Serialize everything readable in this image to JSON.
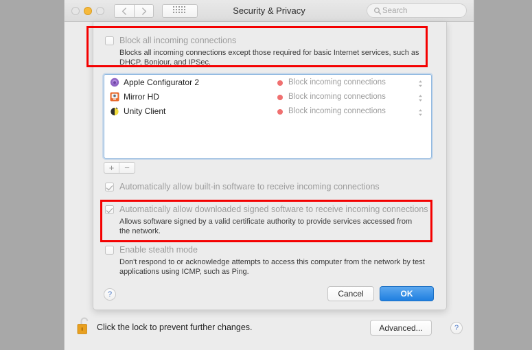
{
  "window": {
    "title": "Security & Privacy",
    "traffic_lights": [
      "close",
      "minimize",
      "zoom"
    ],
    "nav_back": "back",
    "nav_forward": "forward",
    "show_all": "show-all",
    "search_placeholder": "Search"
  },
  "sheet": {
    "block_all": {
      "label": "Block all incoming connections",
      "checked": false,
      "description": "Blocks all incoming connections except those required for basic Internet services, such as DHCP, Bonjour, and IPSec."
    },
    "app_list": {
      "apps": [
        {
          "name": "Apple Configurator 2",
          "icon": "apple-configurator-icon",
          "status": "Block incoming connections",
          "status_color": "#f07070"
        },
        {
          "name": "Mirror HD",
          "icon": "mirror-hd-icon",
          "status": "Block incoming connections",
          "status_color": "#f07070"
        },
        {
          "name": "Unity Client",
          "icon": "unity-client-icon",
          "status": "Block incoming connections",
          "status_color": "#f07070"
        }
      ]
    },
    "add_label": "+",
    "remove_label": "−",
    "builtin": {
      "label": "Automatically allow built-in software to receive incoming connections",
      "checked": true
    },
    "signed": {
      "label": "Automatically allow downloaded signed software to receive incoming connections",
      "checked": true,
      "description": "Allows software signed by a valid certificate authority to provide services accessed from the network."
    },
    "stealth": {
      "label": "Enable stealth mode",
      "checked": false,
      "description": "Don't respond to or acknowledge attempts to access this computer from the network by test applications using ICMP, such as Ping."
    },
    "help_label": "?",
    "cancel_label": "Cancel",
    "ok_label": "OK"
  },
  "lockbar": {
    "lock_icon": "unlocked-padlock-icon",
    "text": "Click the lock to prevent further changes.",
    "advanced_label": "Advanced...",
    "help_label": "?"
  },
  "annotations": {
    "color": "#f40000",
    "boxes": [
      "block-all-section",
      "signed-software-section"
    ]
  }
}
